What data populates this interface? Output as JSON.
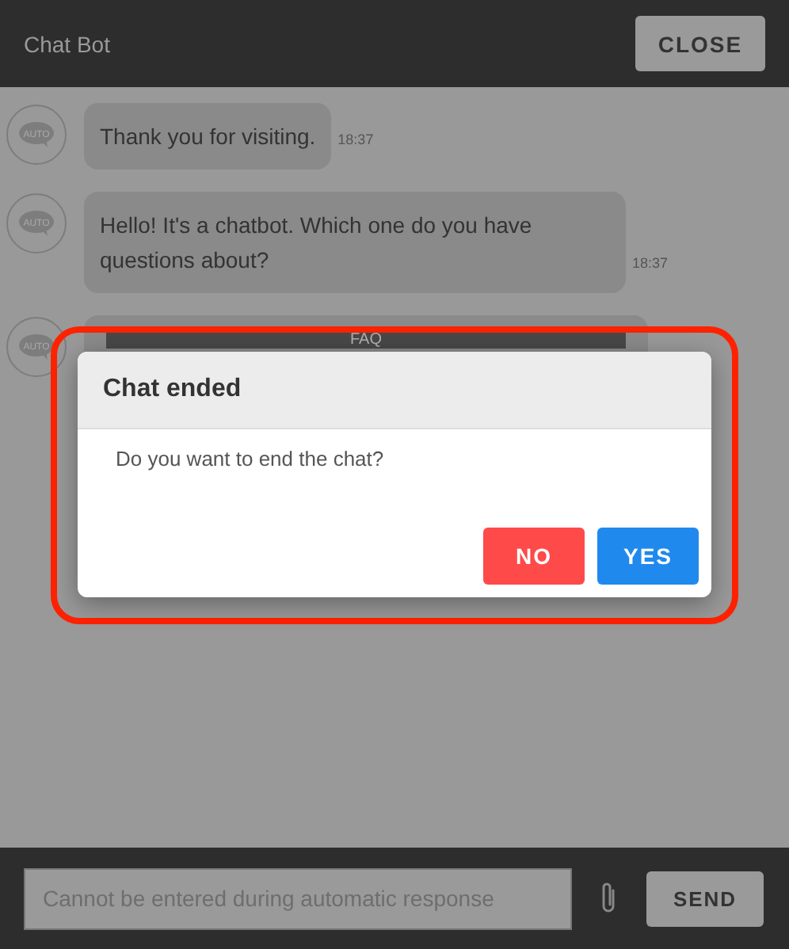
{
  "header": {
    "title": "Chat Bot",
    "close_button": "CLOSE"
  },
  "messages": [
    {
      "avatar": "AUTO",
      "text": "Thank you for visiting.",
      "time": "18:37"
    },
    {
      "avatar": "AUTO",
      "text": "Hello! It's a chatbot. Which one do you have questions about?",
      "time": "18:37"
    },
    {
      "avatar": "AUTO",
      "options": [
        "FAQ"
      ]
    }
  ],
  "dialog": {
    "title": "Chat ended",
    "message": "Do you want to end the chat?",
    "buttons": [
      {
        "label": "NO",
        "kind": "cancel"
      },
      {
        "label": "YES",
        "kind": "confirm"
      }
    ],
    "highlighted": true
  },
  "composer": {
    "placeholder": "Cannot be entered during automatic response",
    "disabled": true,
    "send_button": "SEND"
  }
}
